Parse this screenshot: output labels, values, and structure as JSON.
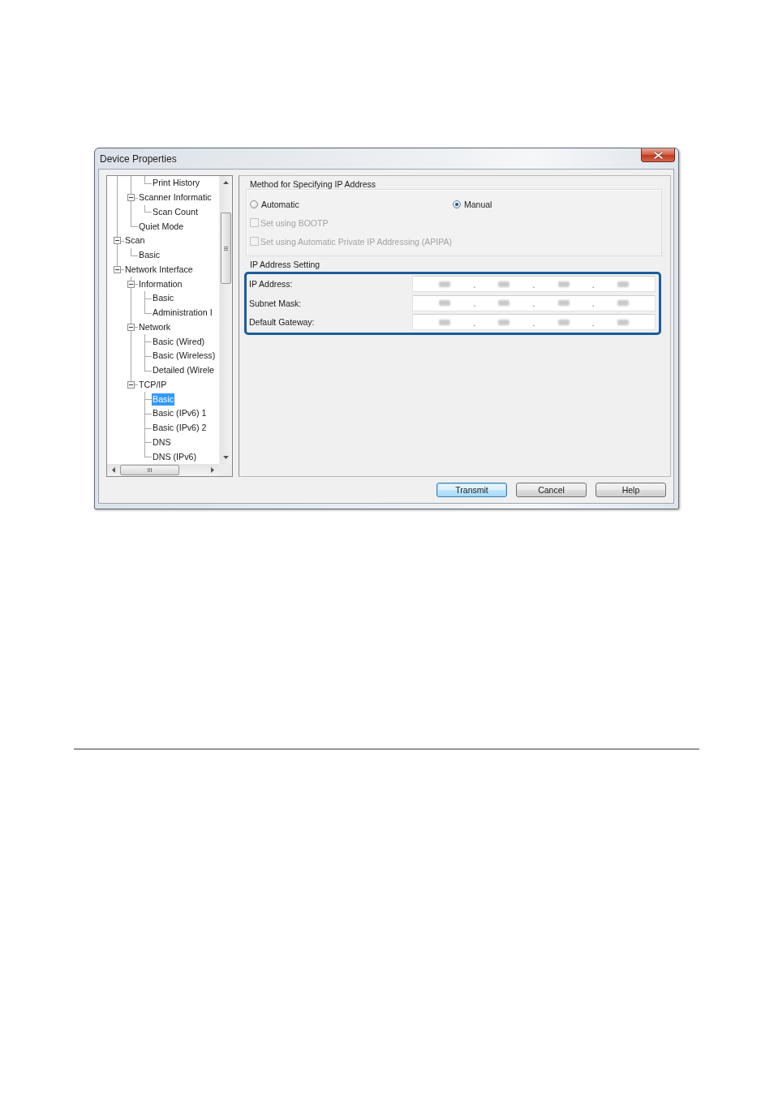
{
  "window": {
    "title": "Device Properties"
  },
  "tree": {
    "items": [
      {
        "children": [
          {
            "children": [
              {
                "label": "Print History",
                "selected": false
              }
            ]
          },
          {
            "label": "Scanner Informatic",
            "expanded": true,
            "selected": false,
            "children": [
              {
                "label": "Scan Count",
                "selected": false
              }
            ]
          },
          {
            "label": "Quiet Mode",
            "selected": false
          }
        ]
      },
      {
        "label": "Scan",
        "expanded": true,
        "selected": false,
        "children": [
          {
            "label": "Basic",
            "selected": false
          }
        ]
      },
      {
        "label": "Network Interface",
        "expanded": true,
        "selected": false,
        "children": [
          {
            "label": "Information",
            "expanded": true,
            "selected": false,
            "children": [
              {
                "label": "Basic",
                "selected": false
              },
              {
                "label": "Administration I",
                "selected": false
              }
            ]
          },
          {
            "label": "Network",
            "expanded": true,
            "selected": false,
            "children": [
              {
                "label": "Basic (Wired)",
                "selected": false
              },
              {
                "label": "Basic (Wireless)",
                "selected": false
              },
              {
                "label": "Detailed (Wirele",
                "selected": false
              }
            ]
          },
          {
            "label": "TCP/IP",
            "expanded": true,
            "selected": false,
            "children": [
              {
                "label": "Basic",
                "selected": true
              },
              {
                "label": "Basic (IPv6) 1",
                "selected": false
              },
              {
                "label": "Basic (IPv6) 2",
                "selected": false
              },
              {
                "label": "DNS",
                "selected": false
              },
              {
                "label": "DNS (IPv6)",
                "selected": false
              }
            ]
          }
        ]
      }
    ]
  },
  "ip_method": {
    "title": "Method for Specifying IP Address",
    "options": [
      {
        "label": "Automatic",
        "selected": false
      },
      {
        "label": "Manual",
        "selected": true
      }
    ],
    "checkboxes": [
      {
        "label": "Set using BOOTP",
        "checked": false,
        "disabled": true
      },
      {
        "label": "Set using Automatic Private IP Addressing (APIPA)",
        "checked": false,
        "disabled": true
      }
    ]
  },
  "ip_setting": {
    "title": "IP Address Setting",
    "highlighted": true,
    "fields": [
      {
        "label": "IP Address:",
        "separators": [
          ".",
          ".",
          "."
        ]
      },
      {
        "label": "Subnet Mask:",
        "separators": [
          ".",
          ".",
          "."
        ]
      },
      {
        "label": "Default Gateway:",
        "separators": [
          ".",
          ".",
          "."
        ]
      }
    ]
  },
  "buttons": [
    {
      "label": "Transmit",
      "default": true
    },
    {
      "label": "Cancel",
      "default": false
    },
    {
      "label": "Help",
      "default": false
    }
  ]
}
